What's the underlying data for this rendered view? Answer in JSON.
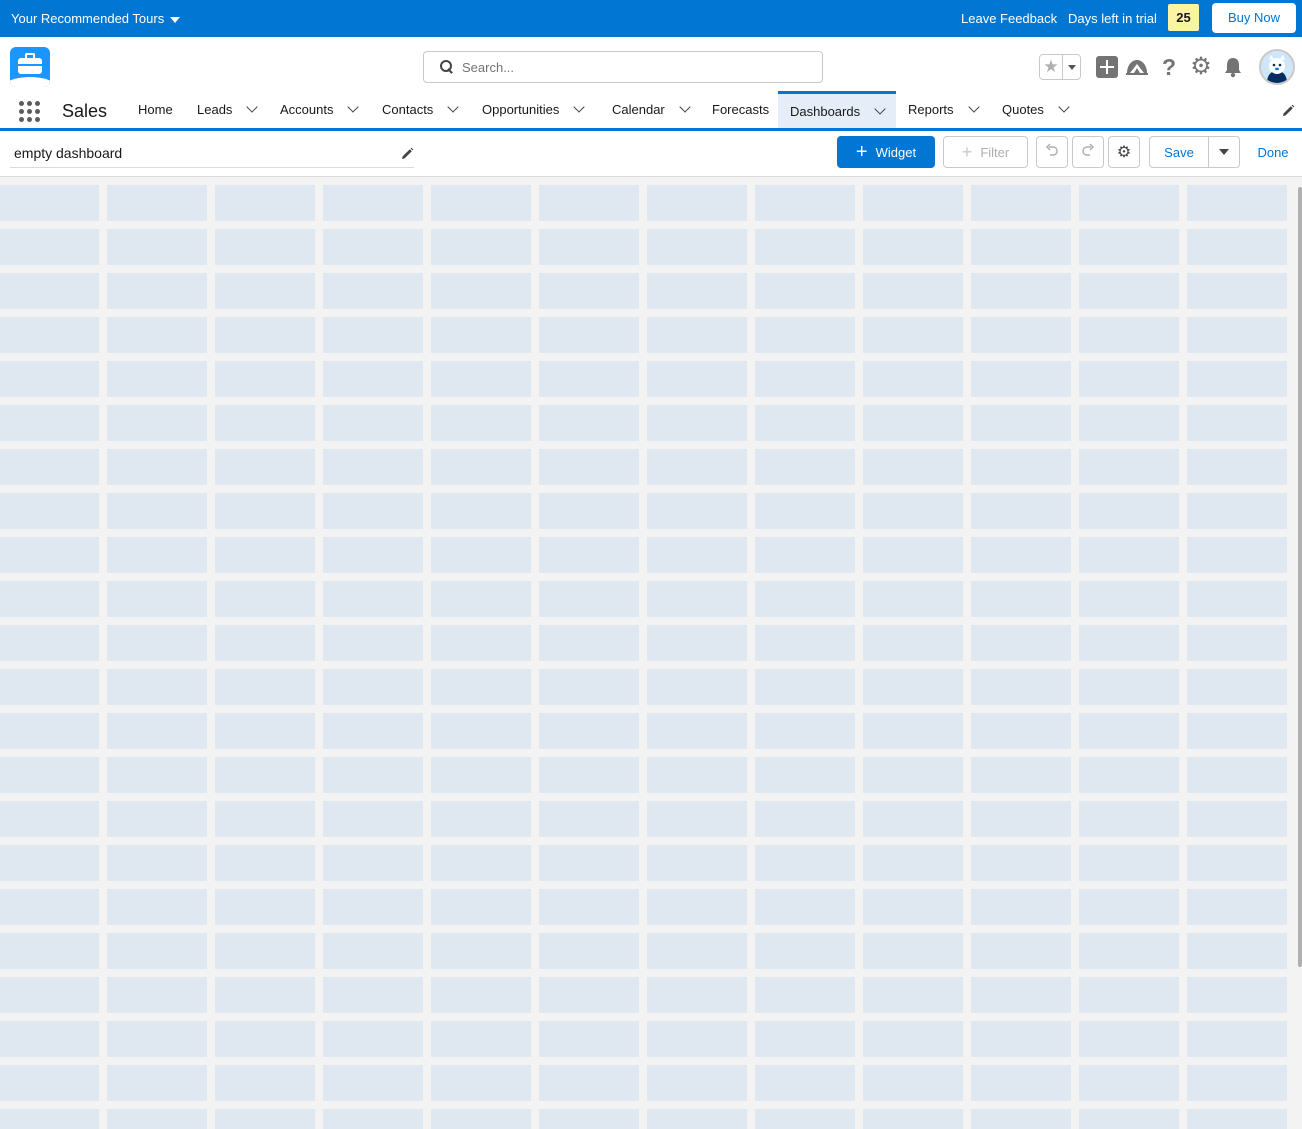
{
  "trial_bar": {
    "tours_label": "Your Recommended Tours",
    "feedback_label": "Leave Feedback",
    "days_label": "Days left in trial",
    "days_count": "25",
    "buy_label": "Buy Now"
  },
  "header": {
    "search_placeholder": "Search...",
    "icons": [
      "favorites-star-icon",
      "global-actions-plus-icon",
      "trailhead-icon",
      "help-icon",
      "setup-gear-icon",
      "notifications-bell-icon",
      "user-avatar"
    ]
  },
  "nav": {
    "app_name": "Sales",
    "items": [
      {
        "label": "Home",
        "has_menu": false
      },
      {
        "label": "Leads",
        "has_menu": true
      },
      {
        "label": "Accounts",
        "has_menu": true
      },
      {
        "label": "Contacts",
        "has_menu": true
      },
      {
        "label": "Opportunities",
        "has_menu": true
      },
      {
        "label": "Calendar",
        "has_menu": true
      },
      {
        "label": "Forecasts",
        "has_menu": false
      },
      {
        "label": "Dashboards",
        "has_menu": true,
        "active": true
      },
      {
        "label": "Reports",
        "has_menu": true
      },
      {
        "label": "Quotes",
        "has_menu": true
      }
    ]
  },
  "toolbar": {
    "dashboard_title": "empty dashboard",
    "widget_label": "Widget",
    "filter_label": "Filter",
    "save_label": "Save",
    "done_label": "Done"
  },
  "canvas": {
    "columns": 12,
    "rows": 22
  },
  "colors": {
    "brand": "#0176d3",
    "trial_badge": "#fcf4a3",
    "grid_cell": "#dfe7f1"
  }
}
